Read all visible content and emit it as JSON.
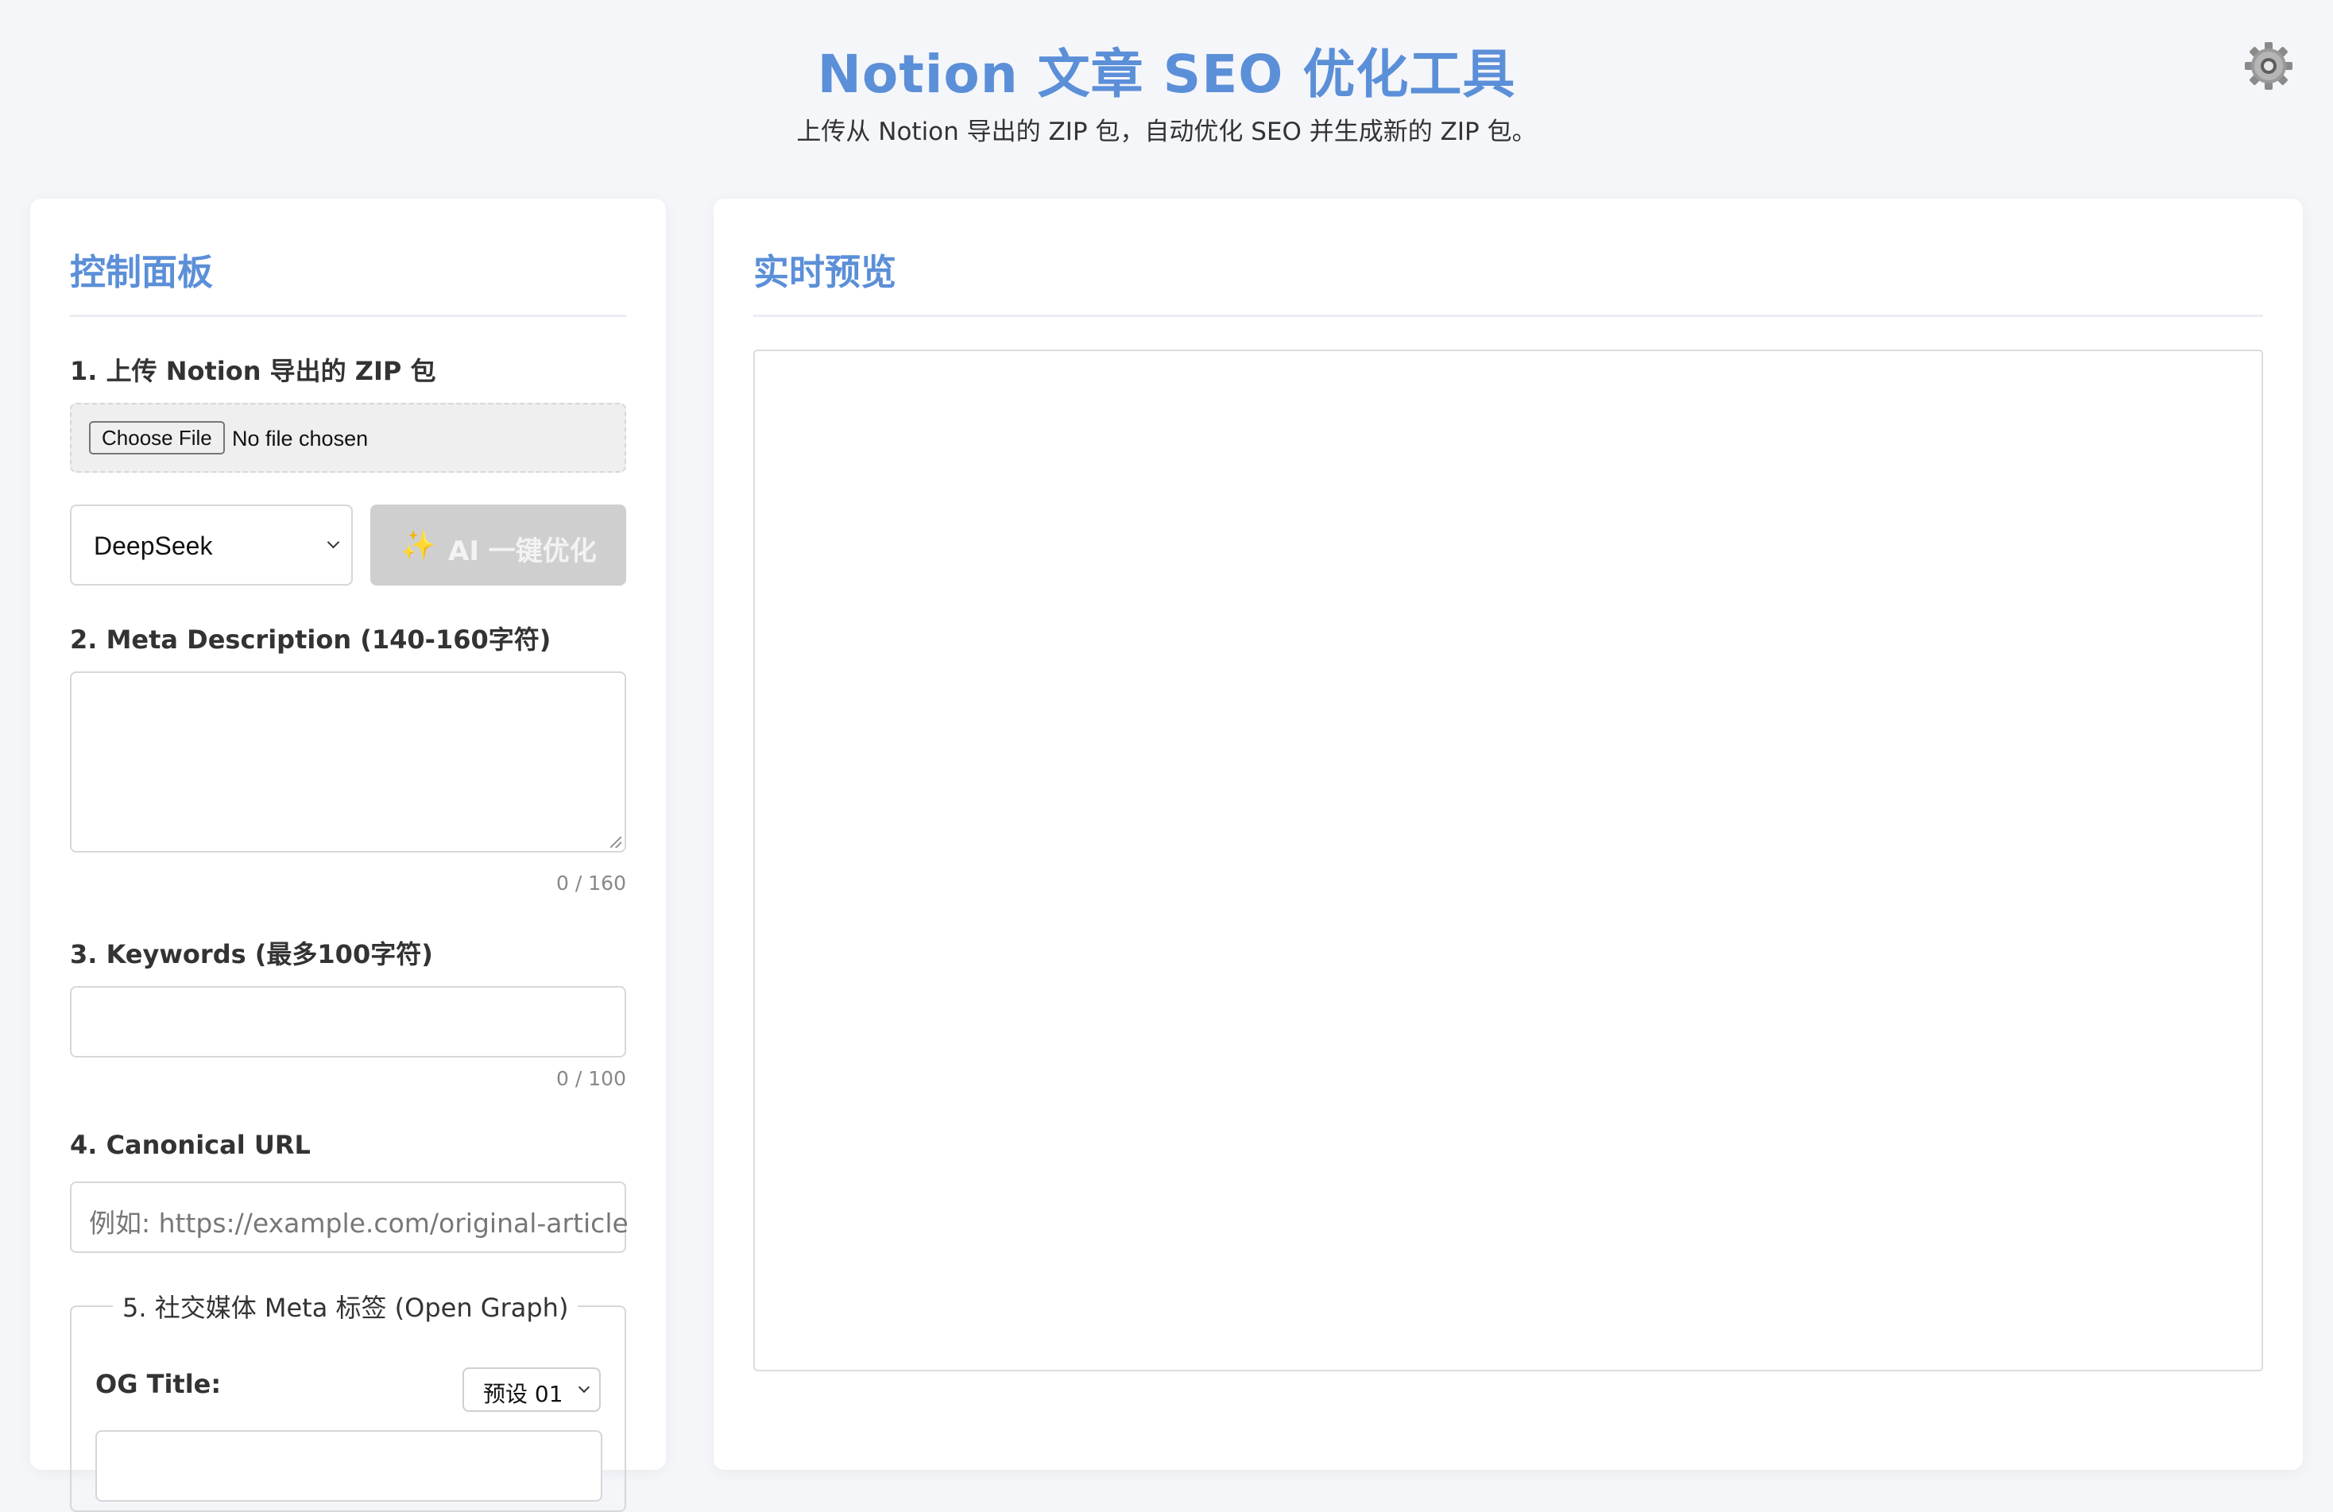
{
  "header": {
    "title": "Notion 文章 SEO 优化工具",
    "subtitle": "上传从 Notion 导出的 ZIP 包，自动优化 SEO 并生成新的 ZIP 包。",
    "settings_icon": "gear-icon"
  },
  "control_panel": {
    "title": "控制面板",
    "upload": {
      "label": "1. 上传 Notion 导出的 ZIP 包",
      "button_label": "Choose File",
      "status": "No file chosen"
    },
    "model_select": {
      "selected": "DeepSeek"
    },
    "ai_button": {
      "icon": "sparkles-icon",
      "label": "AI 一键优化"
    },
    "meta_description": {
      "label": "2. Meta Description (140-160字符)",
      "value": "",
      "counter": "0 / 160"
    },
    "keywords": {
      "label": "3. Keywords (最多100字符)",
      "value": "",
      "counter": "0 / 100"
    },
    "canonical_url": {
      "label": "4. Canonical URL",
      "placeholder": "例如: https://example.com/original-article"
    },
    "open_graph": {
      "legend": "5. 社交媒体 Meta 标签 (Open Graph)",
      "og_title_label": "OG Title:",
      "preset_selected": "预设 01"
    }
  },
  "preview_panel": {
    "title": "实时预览"
  },
  "colors": {
    "accent": "#5b8fd8",
    "background": "#f5f6fa",
    "button_disabled": "#cfcfcf"
  }
}
